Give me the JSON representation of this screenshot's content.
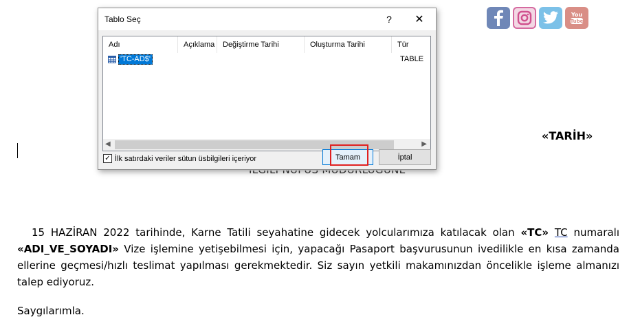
{
  "dialog": {
    "title": "Tablo Seç",
    "help_glyph": "?",
    "close_glyph": "✕",
    "columns": [
      "Adı",
      "Açıklama",
      "Değiştirme Tarihi",
      "Oluşturma Tarihi",
      "Tür"
    ],
    "rows": [
      {
        "name": "'TC-AD$'",
        "type": "TABLE",
        "selected": true
      }
    ],
    "header_checkbox": {
      "label": "İlk satırdaki veriler sütun üsbilgileri içeriyor",
      "checked": true
    },
    "ok_label": "Tamam",
    "cancel_label": "İptal",
    "highlight_color": "#e02020"
  },
  "document": {
    "social_icons": [
      "facebook-icon",
      "instagram-icon",
      "twitter-icon",
      "youtube-icon"
    ],
    "tarih_field": "«TARİH»",
    "heading_partial": "İLGİLİ NÜFUS MÜDÜRLÜĞÜNE",
    "paragraph": {
      "p1": "15 HAZİRAN 2022 tarihinde, Karne Tatili seyahatine gidecek yolcularımıza katılacak olan ",
      "field_tc": "«TC»",
      "p2": " ",
      "tc_word": "TC",
      "p3": " numaralı ",
      "field_name": "«ADI_VE_SOYADI»",
      "p4": " Vize işlemine yetişebilmesi için, yapacağı Pasaport başvurusunun ivedilikle en kısa zamanda ellerine geçmesi/hızlı teslimat yapılması gerekmektedir. Siz sayın yetkili makamınızdan öncelikle işleme almanızı talep ediyoruz."
    },
    "closing": "Saygılarımla."
  }
}
